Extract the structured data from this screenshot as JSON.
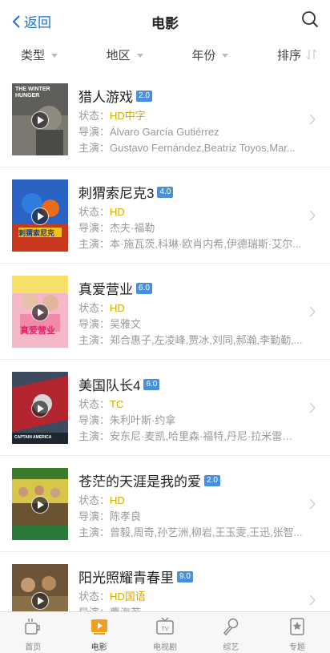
{
  "header": {
    "back_label": "返回",
    "title": "电影"
  },
  "filters": [
    {
      "label": "类型"
    },
    {
      "label": "地区"
    },
    {
      "label": "年份"
    },
    {
      "label": "排序"
    }
  ],
  "row_labels": {
    "status": "状态：",
    "director": "导演：",
    "cast": "主演："
  },
  "movies": [
    {
      "title": "猎人游戏",
      "score": "2.0",
      "status": "HD中字",
      "director": "Álvaro García Gutiérrez",
      "cast": "Gustavo Fernández,Beatriz Toyos,Mar...",
      "poster_text": "THE WINTER HUNGER"
    },
    {
      "title": "刺猬索尼克3",
      "score": "4.0",
      "status": "HD",
      "director": "杰夫·福勒",
      "cast": "本·施瓦茨,科琳·欧肖内希,伊德瑞斯·艾尔...",
      "poster_text": "刺猬索尼克"
    },
    {
      "title": "真爱营业",
      "score": "6.0",
      "status": "HD",
      "director": "吴雅文",
      "cast": "郑合惠子,左凌峰,贾冰,刘同,郝瀚,李勤勤,...",
      "poster_text": "真爱营业"
    },
    {
      "title": "美国队长4",
      "score": "6.0",
      "status": "TC",
      "director": "朱利叶斯·约拿",
      "cast": "安东尼·麦凯,哈里森·福特,丹尼·拉米雷斯,...",
      "poster_text": "CAPTAIN AMERICA"
    },
    {
      "title": "苍茫的天涯是我的爱",
      "score": "2.0",
      "status": "HD",
      "director": "陈孝良",
      "cast": "曾毅,周奇,孙艺洲,柳岩,王玉雯,王迅,张智...",
      "poster_text": ""
    },
    {
      "title": "阳光照耀青春里",
      "score": "9.0",
      "status": "HD国语",
      "director": "曹海若",
      "cast": "",
      "poster_text": ""
    }
  ],
  "tabs": [
    {
      "label": "首页",
      "icon": "cup-icon"
    },
    {
      "label": "电影",
      "icon": "play-icon"
    },
    {
      "label": "电视剧",
      "icon": "tv-icon"
    },
    {
      "label": "综艺",
      "icon": "microphone-icon"
    },
    {
      "label": "专题",
      "icon": "bookmark-star-icon"
    }
  ],
  "colors": {
    "accent": "#1a73c9",
    "active_tab": "#f0a020",
    "status": "#d4a800",
    "score_badge": "#4a90d9"
  }
}
